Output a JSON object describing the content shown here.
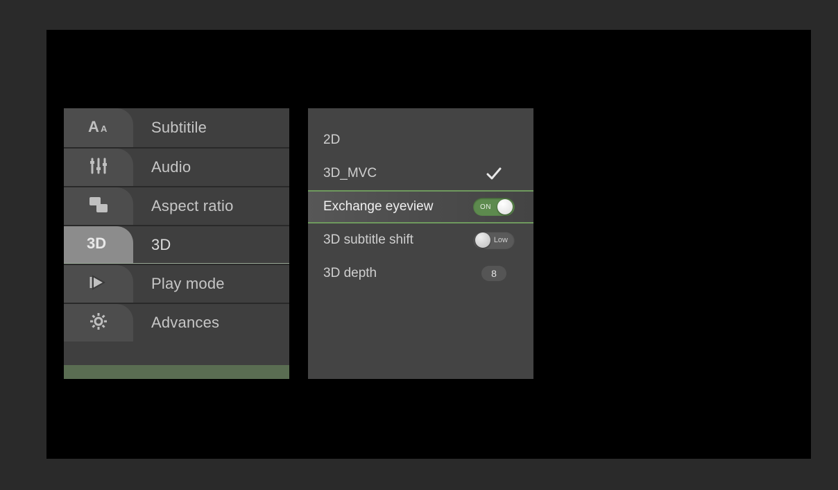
{
  "menu": {
    "items": [
      {
        "label": "Subtitile",
        "icon": "font-size-icon"
      },
      {
        "label": "Audio",
        "icon": "equalizer-icon"
      },
      {
        "label": "Aspect ratio",
        "icon": "aspect-ratio-icon"
      },
      {
        "label": "3D",
        "icon": "three-d-icon",
        "active": true
      },
      {
        "label": "Play mode",
        "icon": "play-mode-icon"
      },
      {
        "label": "Advances",
        "icon": "gear-icon"
      }
    ]
  },
  "panel": {
    "rows": {
      "two_d": {
        "label": "2D"
      },
      "three_d_mvc": {
        "label": "3D_MVC",
        "checked": true
      },
      "exchange_eyeview": {
        "label": "Exchange eyeview",
        "toggle": "ON",
        "selected": true
      },
      "subtitle_shift": {
        "label": "3D subtitle shift",
        "toggle_low": "Low"
      },
      "depth": {
        "label": "3D depth",
        "value": "8"
      }
    }
  }
}
